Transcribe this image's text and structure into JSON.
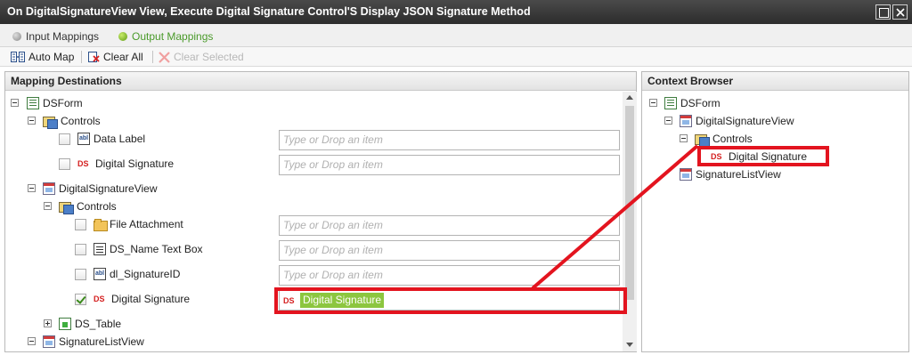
{
  "window": {
    "title": "On DigitalSignatureView View, Execute Digital Signature Control'S Display JSON Signature Method"
  },
  "tabs": {
    "input": "Input Mappings",
    "output": "Output Mappings"
  },
  "toolbar": {
    "auto_map": "Auto Map",
    "clear_all": "Clear All",
    "clear_selected": "Clear Selected"
  },
  "mapping": {
    "header": "Mapping Destinations",
    "placeholder": "Type or Drop an item",
    "tree": {
      "dsform": "DSForm",
      "controls1": "Controls",
      "data_label": "Data Label",
      "digital_signature1": "Digital Signature",
      "digital_signature_view": "DigitalSignatureView",
      "controls2": "Controls",
      "file_attachment": "File Attachment",
      "ds_name_text_box": "DS_Name Text Box",
      "dl_signature_id": "dl_SignatureID",
      "digital_signature2": "Digital Signature",
      "ds_table": "DS_Table",
      "signature_list_view": "SignatureListView"
    },
    "mapped_value": "Digital Signature",
    "ds_badge": "DS"
  },
  "context": {
    "header": "Context Browser",
    "tree": {
      "dsform": "DSForm",
      "digital_signature_view": "DigitalSignatureView",
      "controls": "Controls",
      "digital_signature": "Digital Signature",
      "signature_list_view": "SignatureListView"
    }
  },
  "colors": {
    "highlight": "#e3141f",
    "chip": "#8cc63f",
    "output_tab": "#4a9a2a"
  }
}
